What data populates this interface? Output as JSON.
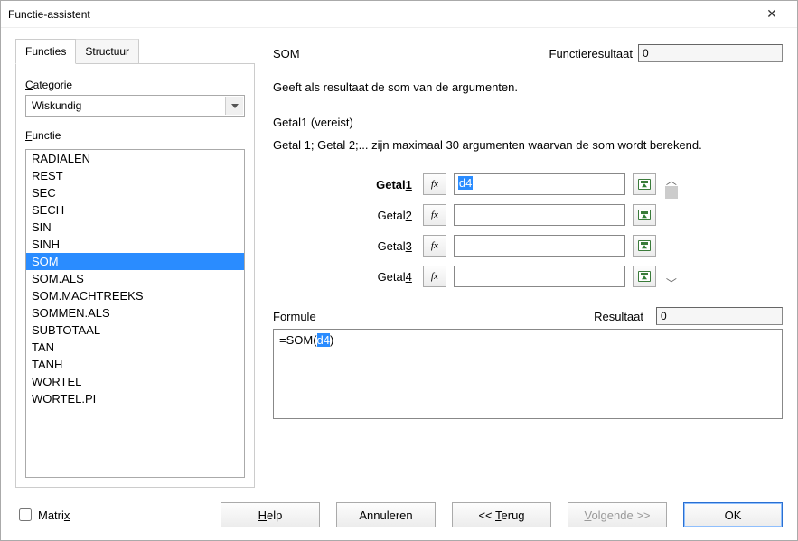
{
  "window": {
    "title": "Functie-assistent"
  },
  "tabs": {
    "tab1": "Functies",
    "tab2": "Structuur"
  },
  "category": {
    "label": "Categorie",
    "label_accel": "C",
    "value": "Wiskundig"
  },
  "functions": {
    "label": "Functie",
    "label_accel": "F",
    "items": [
      "RADIALEN",
      "REST",
      "SEC",
      "SECH",
      "SIN",
      "SINH",
      "SOM",
      "SOM.ALS",
      "SOM.MACHTREEKS",
      "SOMMEN.ALS",
      "SUBTOTAAL",
      "TAN",
      "TANH",
      "WORTEL",
      "WORTEL.PI"
    ],
    "selected_index": 6
  },
  "main": {
    "func_name": "SOM",
    "result_label": "Functieresultaat",
    "result_value": "0",
    "description": "Geeft als resultaat de som van de argumenten.",
    "arg_title": "Getal1 (vereist)",
    "arg_desc": "Getal 1; Getal 2;... zijn maximaal 30 argumenten waarvan de som wordt berekend.",
    "args": [
      {
        "label_plain": "Getal",
        "underline": "1",
        "bold": true,
        "value": "d4"
      },
      {
        "label_plain": "Getal",
        "underline": "2",
        "bold": false,
        "value": ""
      },
      {
        "label_plain": "Getal",
        "underline": "3",
        "bold": false,
        "value": ""
      },
      {
        "label_plain": "Getal",
        "underline": "4",
        "bold": false,
        "value": ""
      }
    ],
    "fx_label": "fx"
  },
  "formula": {
    "label": "Formule",
    "result_label": "Resultaat",
    "result_value": "0",
    "prefix": "=SOM(",
    "highlighted": "d4",
    "suffix": ")"
  },
  "footer": {
    "matrix_label": "Matrix",
    "matrix_accel": "x",
    "help": "Help",
    "help_accel": "H",
    "cancel": "Annuleren",
    "back_prefix": "<<  ",
    "back": "Terug",
    "back_accel": "T",
    "next_prefix": "",
    "next": "Volgende >>",
    "next_accel": "V",
    "ok": "OK"
  }
}
